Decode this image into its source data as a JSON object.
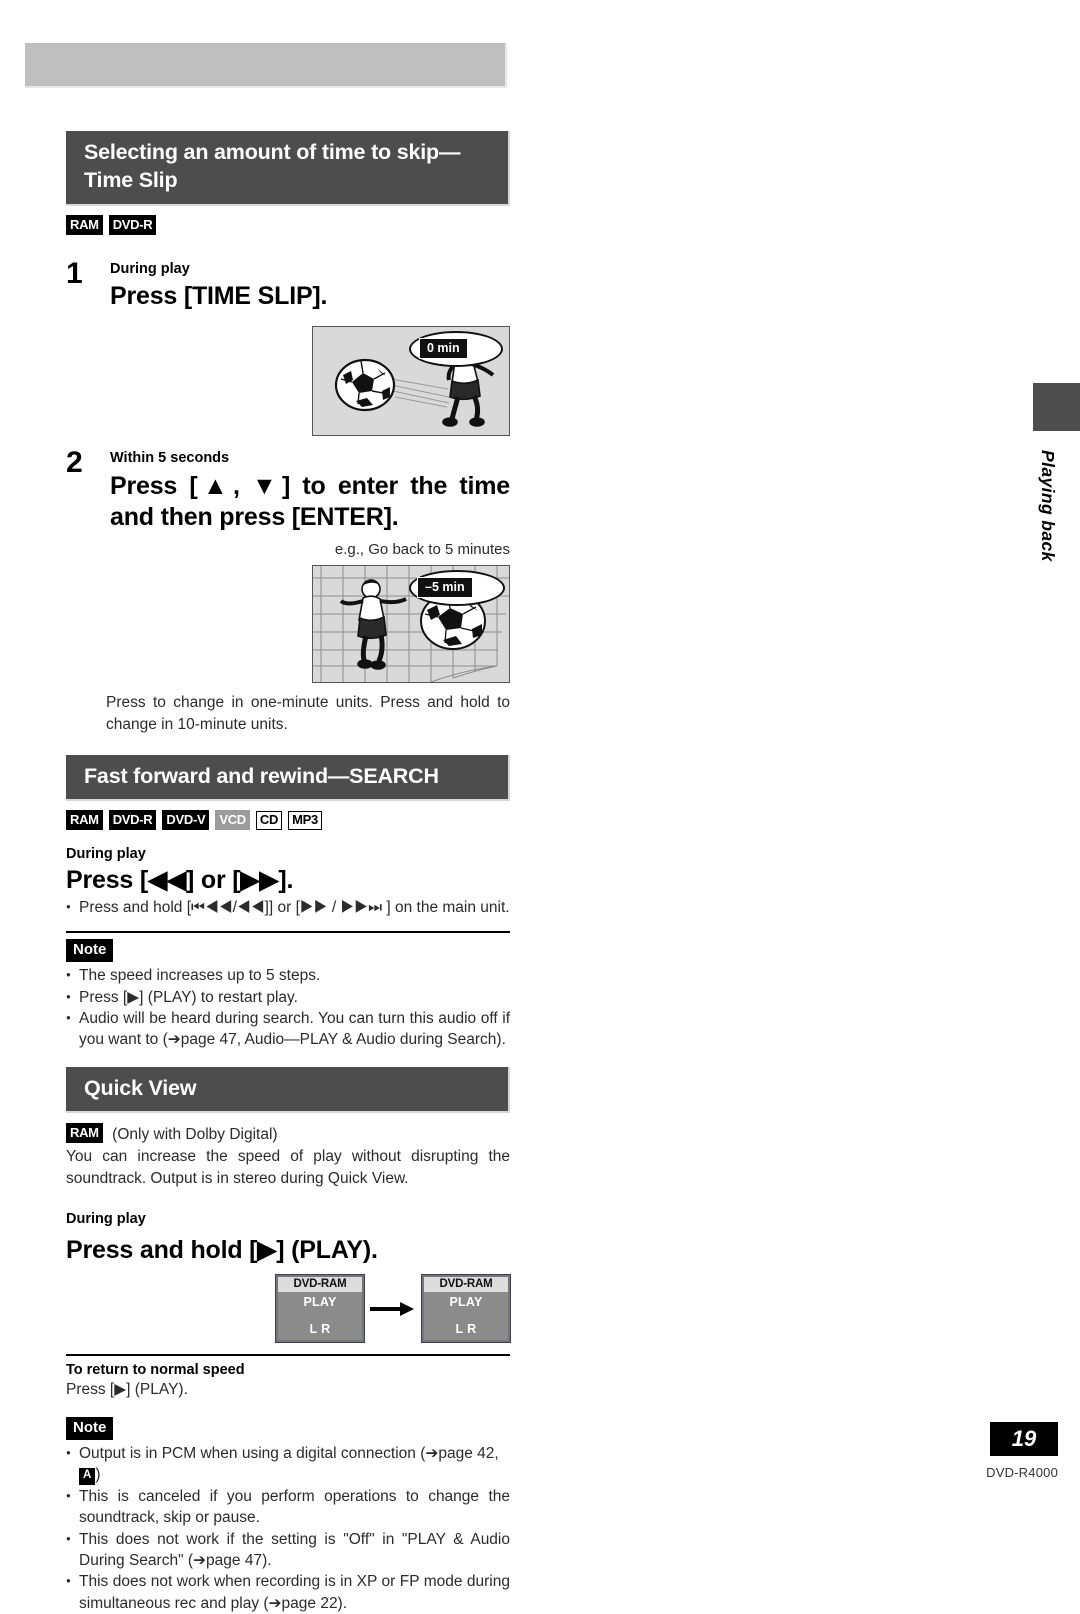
{
  "page": {
    "number": "19",
    "model": "DVD-R4000",
    "side_tab": "Playing back"
  },
  "section_time_slip": {
    "title": "Selecting an amount of time to skip—\nTime Slip",
    "badges": [
      {
        "label": "RAM",
        "style": "black"
      },
      {
        "label": "DVD-R",
        "style": "black"
      }
    ],
    "step1": {
      "num": "1",
      "condition": "During play",
      "instruction": "Press [TIME SLIP]."
    },
    "illustration1": {
      "callout_label": "0 min",
      "alt": "soccer-player-kicking-ball"
    },
    "step2": {
      "num": "2",
      "condition": "Within 5 seconds",
      "instruction": "Press [▲, ▼] to enter the time and then press [ENTER].",
      "example": "e.g.,  Go back to 5 minutes"
    },
    "illustration2": {
      "callout_label": "–5 min",
      "alt": "soccer-ball-in-net"
    },
    "footnote": "Press to change in one-minute units. Press and hold to change in 10-minute units."
  },
  "section_search": {
    "title": "Fast forward and rewind—SEARCH",
    "badges": [
      {
        "label": "RAM",
        "style": "black"
      },
      {
        "label": "DVD-R",
        "style": "black"
      },
      {
        "label": "DVD-V",
        "style": "black"
      },
      {
        "label": "VCD",
        "style": "gray"
      },
      {
        "label": "CD",
        "style": "white"
      },
      {
        "label": "MP3",
        "style": "white"
      }
    ],
    "condition": "During play",
    "instruction": "Press [◀◀] or [▶▶].",
    "sub_bullet": "Press and hold [⏮◀◀/◀◀]] or [▶▶ / ▶▶⏭ ] on the main unit.",
    "note_label": "Note",
    "notes": [
      "The speed increases up to 5 steps.",
      "Press [▶] (PLAY) to restart play.",
      "Audio will be heard during search. You can turn this audio off if you want to (➔page 47, Audio—PLAY  & Audio during Search)."
    ]
  },
  "section_quick_view": {
    "title": "Quick View",
    "badge": {
      "label": "RAM",
      "style": "black"
    },
    "badge_suffix": "(Only with Dolby Digital)",
    "description": "You can increase the speed of play without disrupting the soundtrack. Output is in stereo during Quick View.",
    "condition": "During play",
    "instruction": "Press and hold [▶] (PLAY).",
    "display_before": {
      "header": "DVD-RAM",
      "status": "PLAY",
      "channels": "L R"
    },
    "display_after": {
      "header": "DVD-RAM",
      "status": "PLAY",
      "channels": "L R"
    },
    "return_title": "To return to normal speed",
    "return_text": "Press [▶] (PLAY).",
    "note_label": "Note",
    "notes": [
      "Output is in PCM when using a digital connection (➔page 42, ",
      "This is canceled if you perform operations to change the soundtrack, skip or pause.",
      "This does not work if the setting is \"Off\" in \"PLAY & Audio During Search\" (➔page 47).",
      "This does not work when recording is in XP or FP mode during simultaneous rec and play (➔page 22)."
    ],
    "note_badge_A": "A",
    "note_tail": ")"
  }
}
